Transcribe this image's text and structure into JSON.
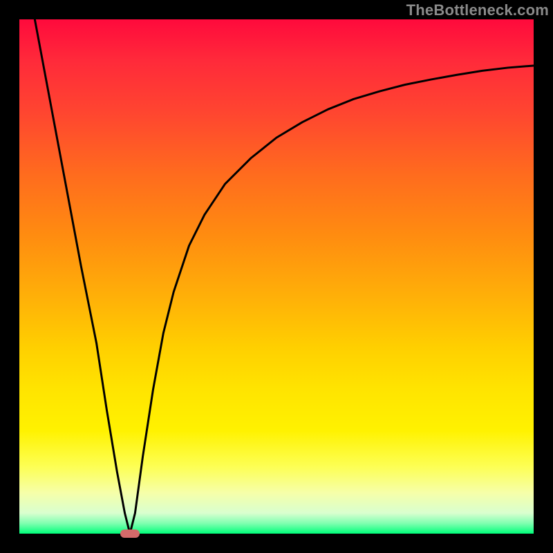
{
  "watermark": "TheBottleneck.com",
  "chart_data": {
    "type": "line",
    "title": "",
    "xlabel": "",
    "ylabel": "",
    "xlim": [
      0,
      100
    ],
    "ylim": [
      0,
      100
    ],
    "grid": false,
    "series": [
      {
        "name": "curve",
        "x": [
          3,
          6,
          9,
          12,
          15,
          17,
          19,
          20.5,
          21.5,
          22.5,
          24,
          26,
          28,
          30,
          33,
          36,
          40,
          45,
          50,
          55,
          60,
          65,
          70,
          75,
          80,
          85,
          90,
          95,
          100
        ],
        "values": [
          100,
          84,
          68,
          52,
          37,
          24,
          12,
          4,
          0,
          4,
          15,
          28,
          39,
          47,
          56,
          62,
          68,
          73,
          77,
          80,
          82.5,
          84.5,
          86,
          87.3,
          88.3,
          89.2,
          90,
          90.6,
          91
        ],
        "color": "#000000"
      }
    ],
    "marker": {
      "x": 21.5,
      "y": 0,
      "color": "#d46a6a"
    }
  }
}
